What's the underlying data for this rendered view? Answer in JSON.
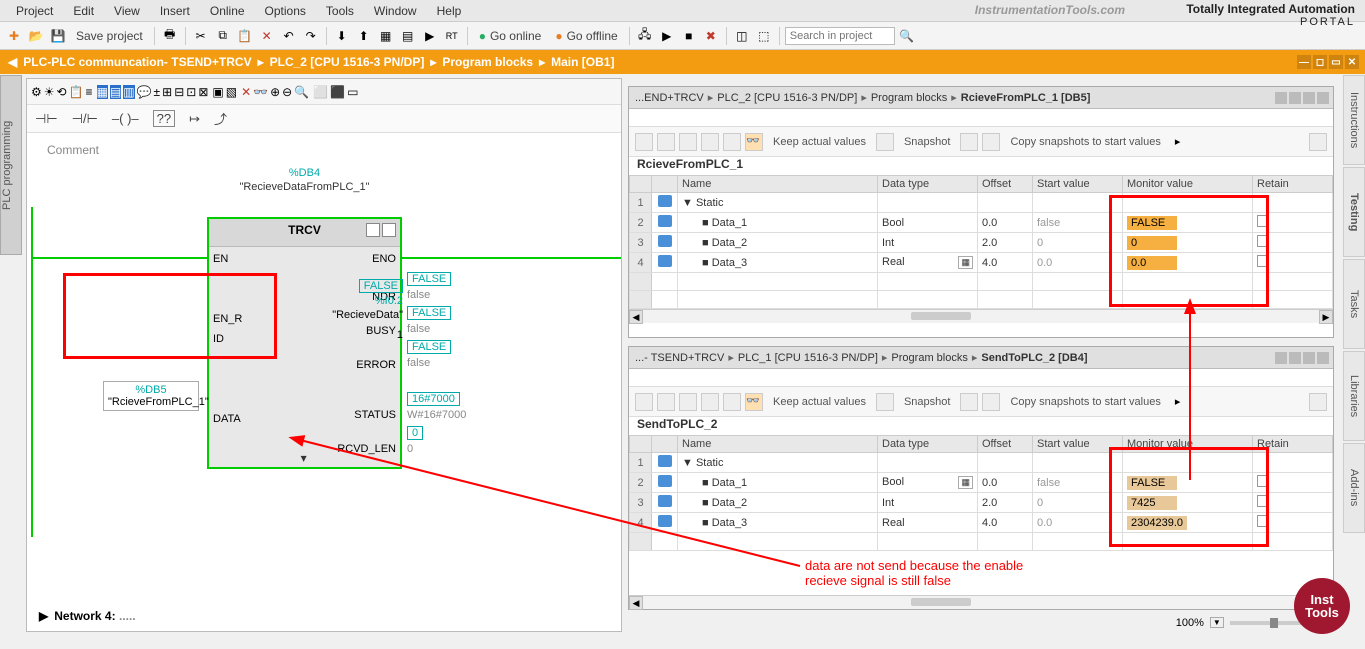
{
  "menu": [
    "Project",
    "Edit",
    "View",
    "Insert",
    "Online",
    "Options",
    "Tools",
    "Window",
    "Help"
  ],
  "watermark": "InstrumentationTools.com",
  "brand": {
    "line1": "Totally Integrated Automation",
    "line2": "PORTAL"
  },
  "toolbar": {
    "save": "Save project",
    "online": "Go online",
    "offline": "Go offline",
    "search_ph": "Search in project"
  },
  "breadcrumb": [
    "PLC-PLC communcation- TSEND+TRCV",
    "PLC_2 [CPU 1516-3 PN/DP]",
    "Program blocks",
    "Main [OB1]"
  ],
  "vtab_left": "PLC programming",
  "rtabs": [
    "Instructions",
    "Testing",
    "Tasks",
    "Libraries",
    "Add-ins"
  ],
  "editor": {
    "comment": "Comment",
    "fbd": {
      "db": "%DB4",
      "inst_name": "\"RecieveDataFromPLC_1\"",
      "block": "TRCV",
      "left_ports": [
        "EN",
        "EN_R",
        "ID",
        "DATA"
      ],
      "right_ports": [
        "ENO",
        "NDR",
        "BUSY",
        "ERROR",
        "STATUS",
        "RCVD_LEN"
      ],
      "en_r_val": "FALSE",
      "en_r_addr": "%I0.2",
      "en_r_tag": "\"RecieveData\"",
      "id_val": "1",
      "data_addr": "%DB5",
      "data_tag": "\"RcieveFromPLC_1\"",
      "ndr": "FALSE",
      "ndr_v": "false",
      "busy": "FALSE",
      "busy_v": "false",
      "error": "FALSE",
      "error_v": "false",
      "status": "16#7000",
      "status_v": "W#16#7000",
      "len": "0",
      "len_v": "0"
    },
    "network": "Network 4:",
    "network_rest": "....."
  },
  "panel1": {
    "title_parts": [
      "...END+TRCV",
      "PLC_2 [CPU 1516-3 PN/DP]",
      "Program blocks",
      "RcieveFromPLC_1 [DB5]"
    ],
    "tools": {
      "keep": "Keep actual values",
      "snap": "Snapshot",
      "copy": "Copy snapshots to start values"
    },
    "name": "RcieveFromPLC_1",
    "cols": [
      "",
      "",
      "Name",
      "Data type",
      "Offset",
      "Start value",
      "Monitor value",
      "Retain"
    ],
    "rows": [
      {
        "n": "1",
        "name": "Static",
        "static": true
      },
      {
        "n": "2",
        "name": "Data_1",
        "dt": "Bool",
        "off": "0.0",
        "sv": "false",
        "mv": "FALSE"
      },
      {
        "n": "3",
        "name": "Data_2",
        "dt": "Int",
        "off": "2.0",
        "sv": "0",
        "mv": "0"
      },
      {
        "n": "4",
        "name": "Data_3",
        "dt": "Real",
        "off": "4.0",
        "sv": "0.0",
        "mv": "0.0"
      }
    ]
  },
  "panel2": {
    "title_parts": [
      "...- TSEND+TRCV",
      "PLC_1 [CPU 1516-3 PN/DP]",
      "Program blocks",
      "SendToPLC_2 [DB4]"
    ],
    "tools": {
      "keep": "Keep actual values",
      "snap": "Snapshot",
      "copy": "Copy snapshots to start values"
    },
    "name": "SendToPLC_2",
    "cols": [
      "",
      "",
      "Name",
      "Data type",
      "Offset",
      "Start value",
      "Monitor value",
      "Retain"
    ],
    "rows": [
      {
        "n": "1",
        "name": "Static",
        "static": true
      },
      {
        "n": "2",
        "name": "Data_1",
        "dt": "Bool",
        "off": "0.0",
        "sv": "false",
        "mv": "FALSE"
      },
      {
        "n": "3",
        "name": "Data_2",
        "dt": "Int",
        "off": "2.0",
        "sv": "0",
        "mv": "7425"
      },
      {
        "n": "4",
        "name": "Data_3",
        "dt": "Real",
        "off": "4.0",
        "sv": "0.0",
        "mv": "2304239.0"
      }
    ]
  },
  "annotation": {
    "line1": "data are not send because the enable",
    "line2": "recieve signal is still false"
  },
  "zoom": "100%",
  "logo": {
    "l1": "Inst",
    "l2": "Tools"
  }
}
